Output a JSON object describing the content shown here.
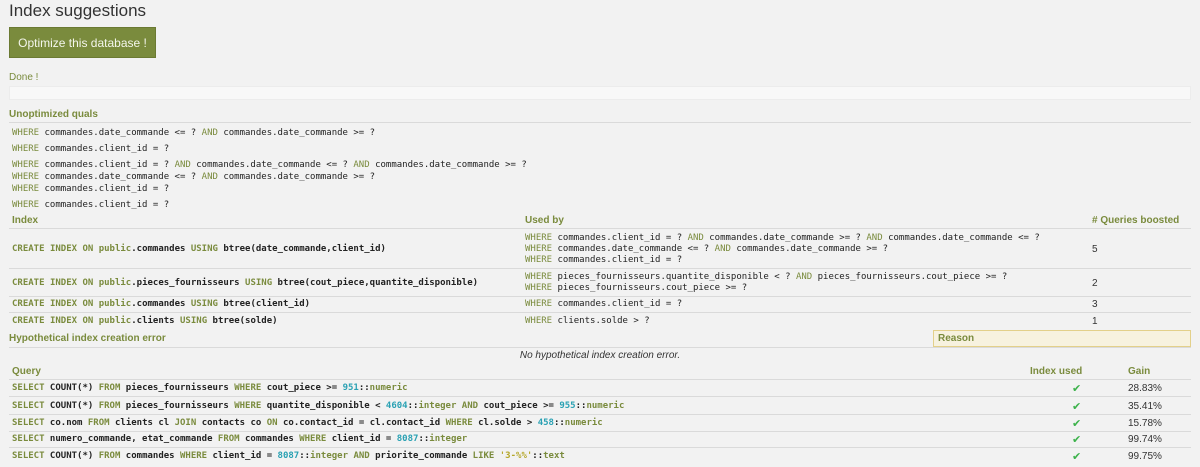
{
  "page": {
    "title": "Index suggestions"
  },
  "optimize_button": {
    "label": "Optimize this database !"
  },
  "status": {
    "text": "Done !"
  },
  "unoptimized": {
    "heading": "Unoptimized quals",
    "groups": [
      [
        "WHERE commandes.date_commande <= ? AND commandes.date_commande >= ?"
      ],
      [
        "WHERE commandes.client_id = ?"
      ],
      [
        "WHERE commandes.client_id = ? AND commandes.date_commande <= ? AND commandes.date_commande >= ?",
        "WHERE commandes.date_commande <= ? AND commandes.date_commande >= ?",
        "WHERE commandes.client_id = ?"
      ],
      [
        "WHERE commandes.client_id = ?"
      ]
    ]
  },
  "index_table": {
    "headers": {
      "index": "Index",
      "used_by": "Used by",
      "boosted": "# Queries boosted"
    },
    "rows": [
      {
        "index": "CREATE INDEX ON public.commandes USING btree(date_commande,client_id)",
        "used_by": [
          "WHERE commandes.client_id = ? AND commandes.date_commande >= ? AND commandes.date_commande <= ?",
          "WHERE commandes.date_commande <= ? AND commandes.date_commande >= ?",
          "WHERE commandes.client_id = ?"
        ],
        "boosted": "5"
      },
      {
        "index": "CREATE INDEX ON public.pieces_fournisseurs USING btree(cout_piece,quantite_disponible)",
        "used_by": [
          "WHERE pieces_fournisseurs.quantite_disponible < ? AND pieces_fournisseurs.cout_piece >= ?",
          "WHERE pieces_fournisseurs.cout_piece >= ?"
        ],
        "boosted": "2"
      },
      {
        "index": "CREATE INDEX ON public.commandes USING btree(client_id)",
        "used_by": [
          "WHERE commandes.client_id = ?"
        ],
        "boosted": "3"
      },
      {
        "index": "CREATE INDEX ON public.clients USING btree(solde)",
        "used_by": [
          "WHERE clients.solde > ?"
        ],
        "boosted": "1"
      }
    ]
  },
  "hypo_errors": {
    "heading": "Hypothetical index creation error",
    "reason_heading": "Reason",
    "message": "No hypothetical index creation error."
  },
  "query_table": {
    "headers": {
      "query": "Query",
      "index_used": "Index used",
      "gain": "Gain"
    },
    "check_icon": "check-icon",
    "rows": [
      {
        "query": "SELECT COUNT(*) FROM pieces_fournisseurs WHERE cout_piece >= 951::numeric",
        "check": "✔",
        "gain": "28.83%"
      },
      {
        "query": "SELECT COUNT(*) FROM pieces_fournisseurs WHERE quantite_disponible < 4604::integer AND cout_piece >= 955::numeric",
        "check": "✔",
        "gain": "35.41%"
      },
      {
        "query": "SELECT co.nom FROM clients cl JOIN contacts co ON co.contact_id = cl.contact_id WHERE cl.solde > 458::numeric",
        "check": "✔",
        "gain": "15.78%"
      },
      {
        "query": "SELECT numero_commande, etat_commande FROM commandes WHERE client_id = 8087::integer",
        "check": "✔",
        "gain": "99.74%"
      },
      {
        "query": "SELECT COUNT(*) FROM commandes WHERE client_id = 8087::integer AND priorite_commande LIKE '3-%%'::text",
        "check": "✔",
        "gain": "99.75%"
      }
    ]
  },
  "colors": {
    "accent": "#7a8b3d",
    "number": "#2aa1b3",
    "string": "#b5a72a",
    "check": "#3bb24a"
  }
}
